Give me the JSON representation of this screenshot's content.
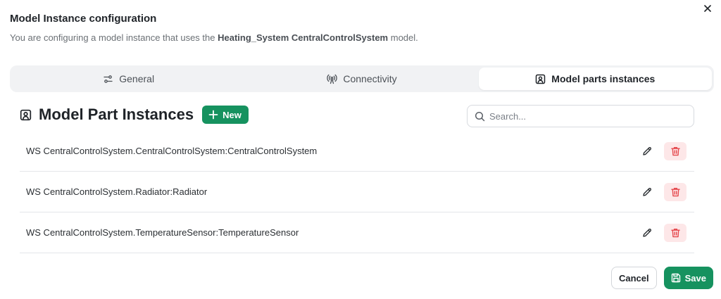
{
  "dialog": {
    "title": "Model Instance configuration",
    "subtitle_prefix": "You are configuring a model instance that uses the ",
    "model_name": "Heating_System CentralControlSystem",
    "subtitle_suffix": " model."
  },
  "tabs": [
    {
      "label": "General",
      "icon": "sliders-icon",
      "active": false
    },
    {
      "label": "Connectivity",
      "icon": "antenna-icon",
      "active": false
    },
    {
      "label": "Model parts instances",
      "icon": "model-part-icon",
      "active": true
    }
  ],
  "section": {
    "title": "Model Part Instances",
    "new_label": "New"
  },
  "search": {
    "placeholder": "Search...",
    "value": ""
  },
  "rows": [
    {
      "label": "WS CentralControlSystem.CentralControlSystem:CentralControlSystem"
    },
    {
      "label": "WS CentralControlSystem.Radiator:Radiator"
    },
    {
      "label": "WS CentralControlSystem.TemperatureSensor:TemperatureSensor"
    }
  ],
  "footer": {
    "cancel_label": "Cancel",
    "save_label": "Save"
  },
  "colors": {
    "accent": "#16925f",
    "danger": "#e5484d",
    "danger_bg": "#fde7e8"
  }
}
